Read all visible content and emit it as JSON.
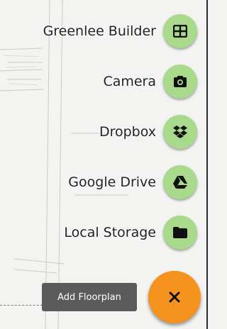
{
  "menu": {
    "items": [
      {
        "label": "Greenlee Builder",
        "icon": "grid-icon"
      },
      {
        "label": "Camera",
        "icon": "camera-icon"
      },
      {
        "label": "Dropbox",
        "icon": "dropbox-icon"
      },
      {
        "label": "Google Drive",
        "icon": "google-drive-icon"
      },
      {
        "label": "Local Storage",
        "icon": "folder-icon"
      }
    ]
  },
  "tooltip": {
    "label": "Add Floorplan"
  },
  "fab": {
    "icon": "close-icon",
    "glyph": "×"
  },
  "colors": {
    "mini_fab": "#a9d98a",
    "main_fab": "#f6921e",
    "tooltip_bg": "#5b5b5b"
  }
}
